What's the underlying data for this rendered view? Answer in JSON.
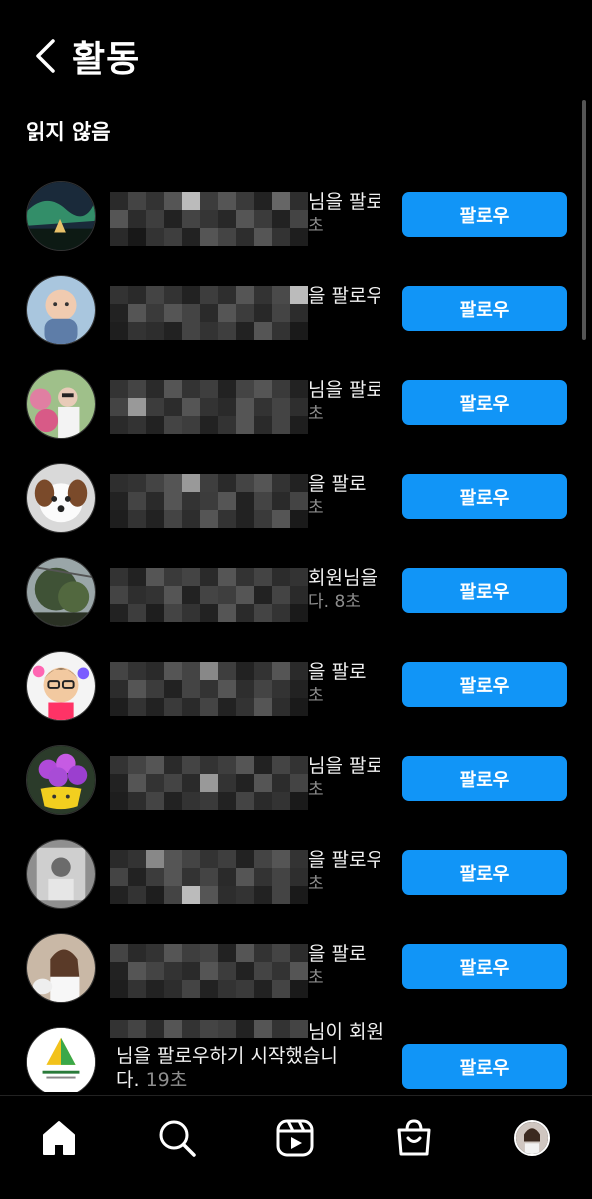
{
  "header": {
    "title": "활동",
    "back_icon": "chevron-left-icon"
  },
  "section": {
    "title": "읽지 않음"
  },
  "items": [
    {
      "line1": "님을 팔로",
      "line2": "초",
      "button": "팔로우",
      "avatar": "aurora"
    },
    {
      "line1": "을 팔로우",
      "line2": "",
      "button": "팔로우",
      "avatar": "baby"
    },
    {
      "line1": "님을 팔로",
      "line2": "초",
      "button": "팔로우",
      "avatar": "flowers-woman"
    },
    {
      "line1": "을 팔로",
      "line2": "초",
      "button": "팔로우",
      "avatar": "puppy"
    },
    {
      "line1": "회원님을",
      "line2": "다. 8초",
      "button": "팔로우",
      "avatar": "tree"
    },
    {
      "line1": "을 팔로",
      "line2": "초",
      "button": "팔로우",
      "avatar": "cartoon-man"
    },
    {
      "line1": "님을 팔로",
      "line2": "초",
      "button": "팔로우",
      "avatar": "flower-pot"
    },
    {
      "line1": "을 팔로우",
      "line2": "초",
      "button": "팔로우",
      "avatar": "man-photo"
    },
    {
      "line1": "을 팔로",
      "line2": "초",
      "button": "팔로우",
      "avatar": "woman-cat"
    }
  ],
  "last_item": {
    "line1": "님이 회원",
    "line2": "님을 팔로우하기 시작했습니",
    "line3_text": "다.",
    "line3_time": "19초",
    "button": "팔로우",
    "avatar": "campground-logo"
  },
  "nav": {
    "home_icon": "home-icon",
    "search_icon": "search-icon",
    "reels_icon": "reels-icon",
    "shop_icon": "shop-icon",
    "profile_icon": "profile-avatar"
  },
  "colors": {
    "accent": "#1195f7",
    "background": "#000000",
    "secondary_text": "#8e8e8e"
  }
}
